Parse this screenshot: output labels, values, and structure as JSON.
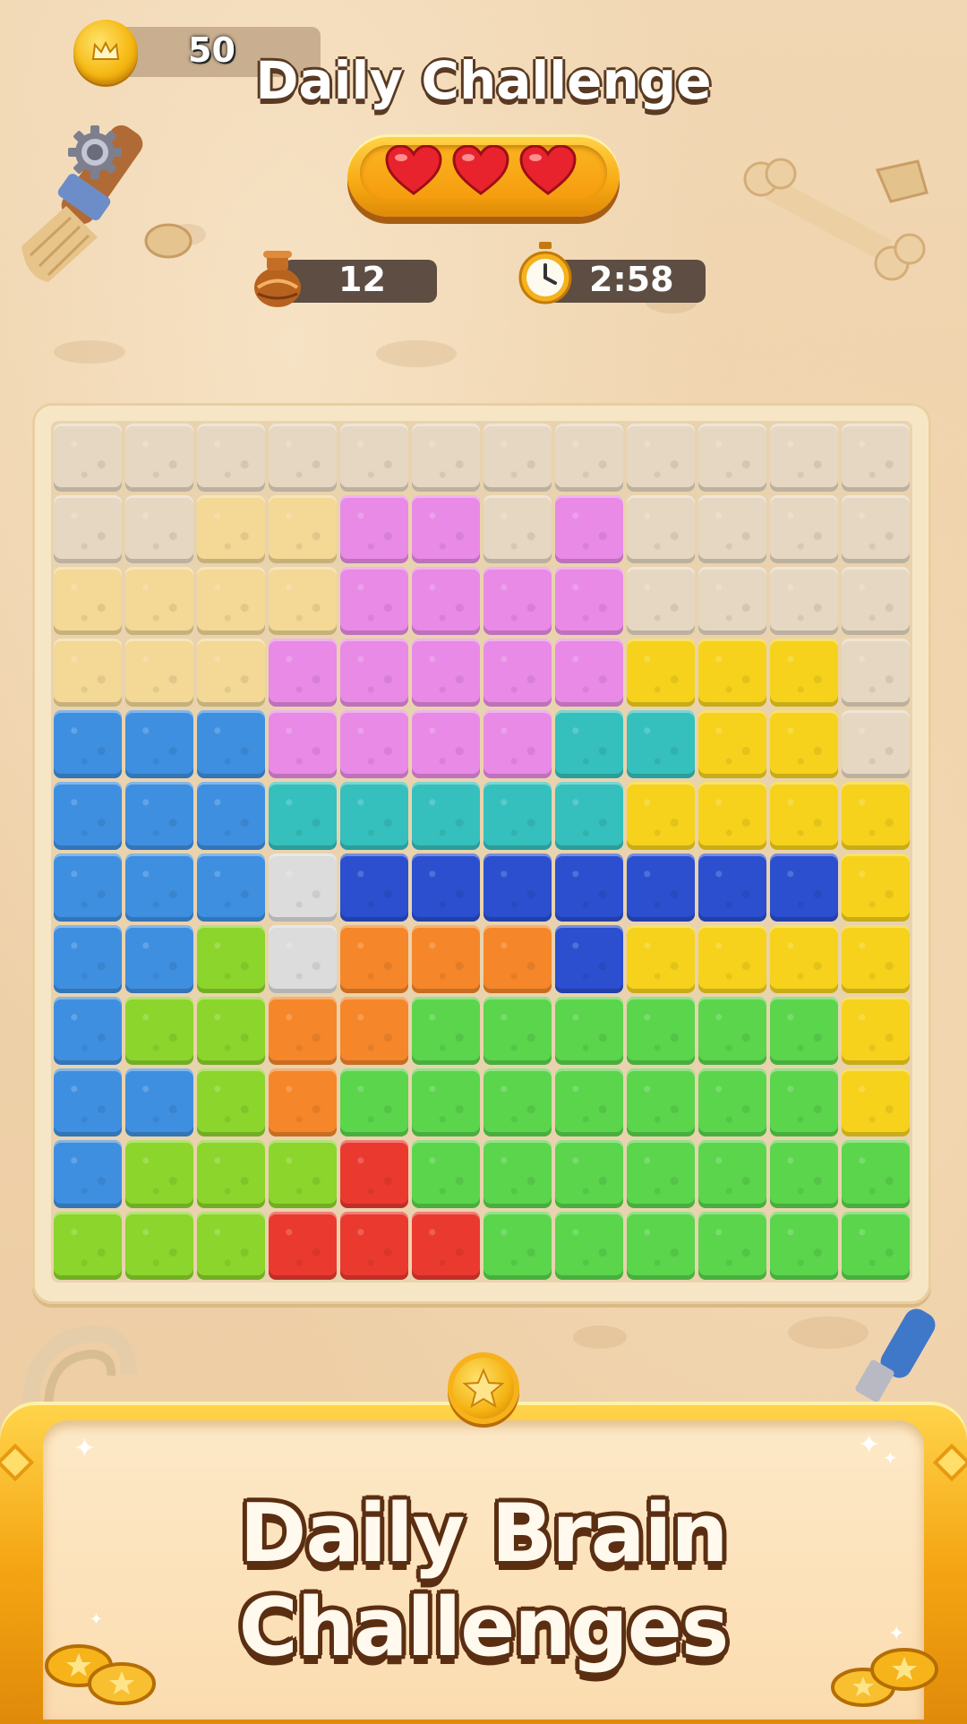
{
  "header": {
    "coins": "50",
    "title": "Daily Challenge",
    "lives_count": 3,
    "jar_count": "12",
    "timer": "2:58"
  },
  "board": {
    "size": 12,
    "palette": {
      "s": "#e6d7c2",
      "y": "#f3d896",
      "p": "#e88ae6",
      "g": "#f6d21c",
      "b": "#3f8fe0",
      "t": "#35c0bd",
      "d": "#2b4fcf",
      "w": "#dcdcdc",
      "l": "#8cd52c",
      "o": "#f5862a",
      "e": "#5ad54c",
      "r": "#ea3a2f"
    },
    "rows": [
      "ssssssssssss",
      "ssyyppsp",
      "yyyypppp",
      "yyyppppp",
      "bbbppppt",
      "bbbtttttt",
      "bbbwdddd",
      "bblwooo",
      "bllooeee",
      "bbloeeee",
      "bllleree",
      "lllrrree"
    ],
    "grid": [
      [
        "s",
        "s",
        "s",
        "s",
        "s",
        "s",
        "s",
        "s",
        "s",
        "s",
        "s",
        "s"
      ],
      [
        "s",
        "s",
        "y",
        "y",
        "p",
        "p",
        "s",
        "p",
        "s",
        "s",
        "s",
        "s"
      ],
      [
        "y",
        "y",
        "y",
        "y",
        "p",
        "p",
        "p",
        "p",
        "s",
        "s",
        "s",
        "s"
      ],
      [
        "y",
        "y",
        "y",
        "p",
        "p",
        "p",
        "p",
        "p",
        "g",
        "g",
        "g",
        "s"
      ],
      [
        "b",
        "b",
        "b",
        "p",
        "p",
        "p",
        "p",
        "t",
        "t",
        "g",
        "g",
        "s"
      ],
      [
        "b",
        "b",
        "b",
        "t",
        "t",
        "t",
        "t",
        "t",
        "g",
        "g",
        "g",
        "g"
      ],
      [
        "b",
        "b",
        "b",
        "w",
        "d",
        "d",
        "d",
        "d",
        "d",
        "d",
        "d",
        "g"
      ],
      [
        "b",
        "b",
        "l",
        "w",
        "o",
        "o",
        "o",
        "d",
        "g",
        "g",
        "g",
        "g"
      ],
      [
        "b",
        "l",
        "l",
        "o",
        "o",
        "e",
        "e",
        "e",
        "e",
        "e",
        "e",
        "g"
      ],
      [
        "b",
        "b",
        "l",
        "o",
        "e",
        "e",
        "e",
        "e",
        "e",
        "e",
        "e",
        "g"
      ],
      [
        "b",
        "l",
        "l",
        "l",
        "r",
        "e",
        "e",
        "e",
        "e",
        "e",
        "e",
        "e"
      ],
      [
        "l",
        "l",
        "l",
        "r",
        "r",
        "r",
        "e",
        "e",
        "e",
        "e",
        "e",
        "e"
      ]
    ]
  },
  "banner": {
    "text": "Daily Brain Challenges"
  }
}
